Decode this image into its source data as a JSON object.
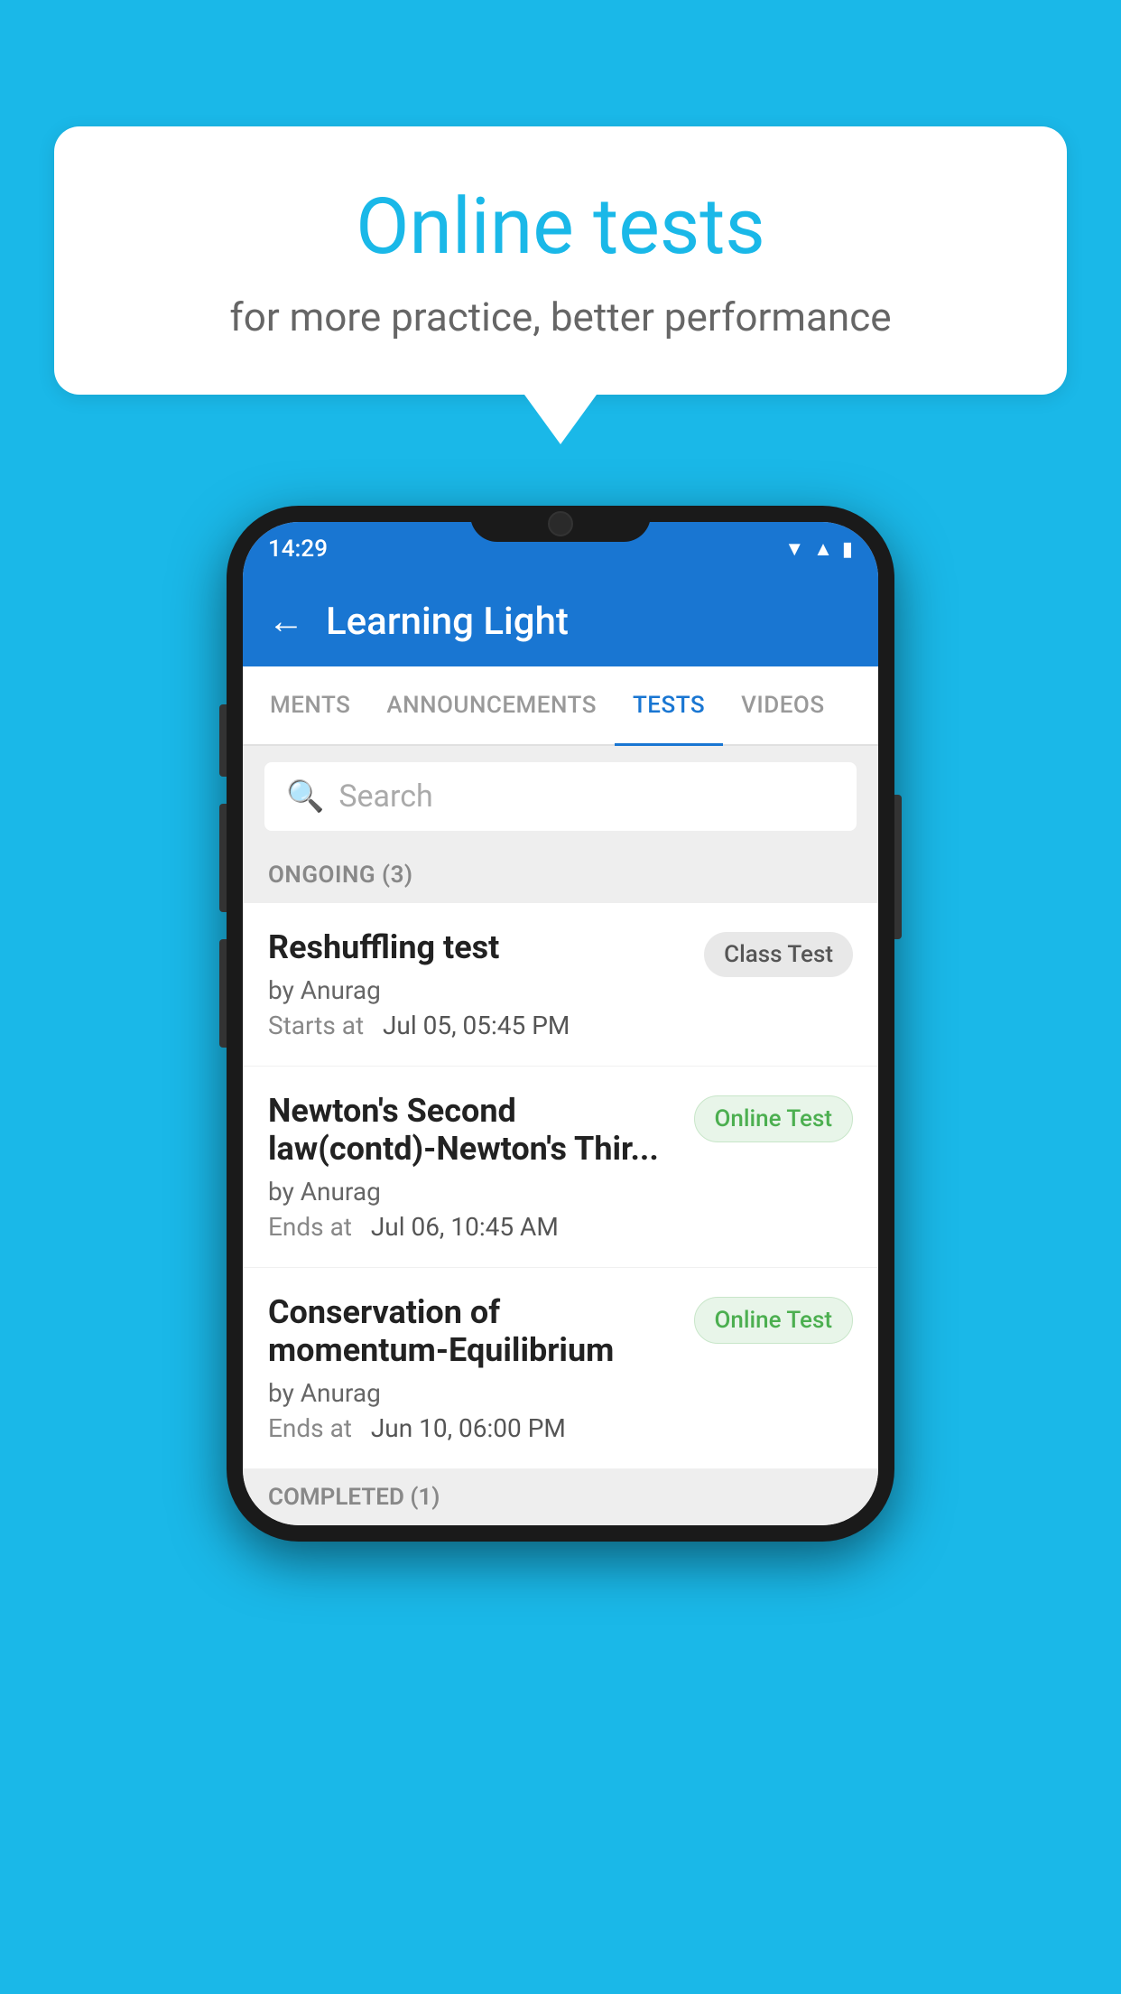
{
  "background": {
    "color": "#1ab8e8"
  },
  "speech_bubble": {
    "title": "Online tests",
    "subtitle": "for more practice, better performance"
  },
  "phone": {
    "status_bar": {
      "time": "14:29",
      "icons": [
        "wifi",
        "signal",
        "battery"
      ]
    },
    "header": {
      "back_label": "←",
      "title": "Learning Light"
    },
    "tabs": [
      {
        "label": "MENTS",
        "active": false
      },
      {
        "label": "ANNOUNCEMENTS",
        "active": false
      },
      {
        "label": "TESTS",
        "active": true
      },
      {
        "label": "VIDEOS",
        "active": false
      }
    ],
    "search": {
      "placeholder": "Search"
    },
    "section_ongoing": {
      "label": "ONGOING (3)"
    },
    "test_items": [
      {
        "name": "Reshuffling test",
        "author": "by Anurag",
        "time_label": "Starts at",
        "time_value": "Jul 05, 05:45 PM",
        "badge": "Class Test",
        "badge_type": "class"
      },
      {
        "name": "Newton's Second law(contd)-Newton's Thir...",
        "author": "by Anurag",
        "time_label": "Ends at",
        "time_value": "Jul 06, 10:45 AM",
        "badge": "Online Test",
        "badge_type": "online"
      },
      {
        "name": "Conservation of momentum-Equilibrium",
        "author": "by Anurag",
        "time_label": "Ends at",
        "time_value": "Jun 10, 06:00 PM",
        "badge": "Online Test",
        "badge_type": "online"
      }
    ],
    "section_completed": {
      "label": "COMPLETED (1)"
    }
  }
}
